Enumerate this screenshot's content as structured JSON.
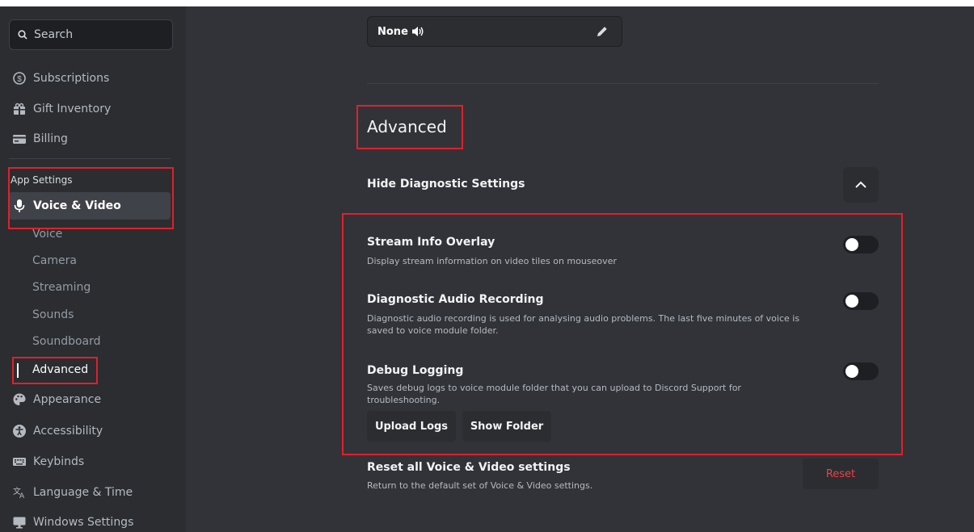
{
  "search": {
    "placeholder": "Search"
  },
  "sidebar": {
    "user_items": [
      {
        "label": "Subscriptions",
        "icon": "subscriptions-icon"
      },
      {
        "label": "Gift Inventory",
        "icon": "gift-icon"
      },
      {
        "label": "Billing",
        "icon": "billing-icon"
      }
    ],
    "section_header": "App Settings",
    "active_item": {
      "label": "Voice & Video",
      "icon": "microphone-icon"
    },
    "sub_items": [
      "Voice",
      "Camera",
      "Streaming",
      "Sounds",
      "Soundboard",
      "Advanced"
    ],
    "app_items": [
      {
        "label": "Appearance",
        "icon": "palette-icon"
      },
      {
        "label": "Accessibility",
        "icon": "accessibility-icon"
      },
      {
        "label": "Keybinds",
        "icon": "keyboard-icon"
      },
      {
        "label": "Language & Time",
        "icon": "language-icon"
      },
      {
        "label": "Windows Settings",
        "icon": "monitor-icon"
      }
    ]
  },
  "main": {
    "sound_select": {
      "value": "None"
    },
    "section_title": "Advanced",
    "hide_diagnostic": "Hide Diagnostic Settings",
    "options": [
      {
        "title": "Stream Info Overlay",
        "desc": "Display stream information on video tiles on mouseover",
        "enabled": false
      },
      {
        "title": "Diagnostic Audio Recording",
        "desc": "Diagnostic audio recording is used for analysing audio problems. The last five minutes of voice is saved to voice module folder.",
        "enabled": false
      },
      {
        "title": "Debug Logging",
        "desc": "Saves debug logs to voice module folder that you can upload to Discord Support for troubleshooting.",
        "enabled": false
      }
    ],
    "upload_logs": "Upload Logs",
    "show_folder": "Show Folder",
    "reset": {
      "title": "Reset all Voice & Video settings",
      "desc": "Return to the default set of Voice & Video settings.",
      "button": "Reset"
    }
  },
  "colors": {
    "background": "#313338",
    "sidebar": "#2b2d31",
    "highlight": "#e0202a",
    "danger": "#f23f42"
  }
}
